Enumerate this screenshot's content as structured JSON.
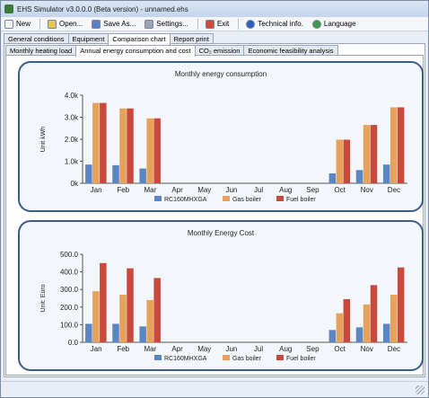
{
  "window": {
    "title": "EHS Simulator v3.0.0.0 (Beta version) - unnamed.ehs"
  },
  "toolbar": {
    "items": [
      {
        "label": "New",
        "icon": "new-file-icon",
        "color": "#f2f2f2"
      },
      {
        "label": "Open...",
        "icon": "open-folder-icon",
        "color": "#e8c25a"
      },
      {
        "label": "Save As...",
        "icon": "save-icon",
        "color": "#5a7fc4"
      },
      {
        "label": "Settings...",
        "icon": "settings-icon",
        "color": "#9aa5b4"
      },
      {
        "label": "Exit",
        "icon": "exit-icon",
        "color": "#d04a3a"
      },
      {
        "label": "Technical info.",
        "icon": "info-icon",
        "color": "#2f5fb8"
      },
      {
        "label": "Language",
        "icon": "globe-icon",
        "color": "#3f9a4a"
      }
    ]
  },
  "main_tabs": [
    "General conditions",
    "Equipment",
    "Comparison chart",
    "Report print"
  ],
  "main_tabs_active": 2,
  "sub_tabs": [
    "Monthly heating load",
    "Annual energy consumption and cost",
    "CO₂ emission",
    "Economic feasibility analysis"
  ],
  "sub_tabs_active": 1,
  "legend_colors": [
    "#5b86c4",
    "#e6a25a",
    "#c94a3c"
  ],
  "chart_data": [
    {
      "type": "bar",
      "title": "Monthly energy consumption",
      "ylabel": "Unit kWh",
      "categories": [
        "Jan",
        "Feb",
        "Mar",
        "Apr",
        "May",
        "Jun",
        "Jul",
        "Aug",
        "Sep",
        "Oct",
        "Nov",
        "Dec"
      ],
      "series": [
        {
          "name": "RC160MHXGA",
          "values": [
            850,
            820,
            670,
            0,
            0,
            0,
            0,
            0,
            0,
            450,
            600,
            850
          ]
        },
        {
          "name": "Gas boiler",
          "values": [
            3650,
            3400,
            2950,
            0,
            0,
            0,
            0,
            0,
            0,
            1980,
            2650,
            3450
          ]
        },
        {
          "name": "Fuel boiler",
          "values": [
            3650,
            3400,
            2950,
            0,
            0,
            0,
            0,
            0,
            0,
            1980,
            2650,
            3450
          ]
        }
      ],
      "ylim": [
        0,
        4000
      ],
      "yticks": [
        0,
        1000,
        2000,
        3000,
        4000
      ],
      "ytick_labels": [
        "0k",
        "1.0k",
        "2.0k",
        "3.0k",
        "4.0k"
      ],
      "grid": false,
      "legend": "bottom"
    },
    {
      "type": "bar",
      "title": "Monthly Energy Cost",
      "ylabel": "Unit: Euro",
      "categories": [
        "Jan",
        "Feb",
        "Mar",
        "Apr",
        "May",
        "Jun",
        "Jul",
        "Aug",
        "Sep",
        "Oct",
        "Nov",
        "Dec"
      ],
      "series": [
        {
          "name": "RC160MHXGA",
          "values": [
            105,
            105,
            90,
            0,
            0,
            0,
            0,
            0,
            0,
            70,
            85,
            105
          ]
        },
        {
          "name": "Gas boiler",
          "values": [
            290,
            270,
            240,
            0,
            0,
            0,
            0,
            0,
            0,
            165,
            215,
            270
          ]
        },
        {
          "name": "Fuel boiler",
          "values": [
            450,
            420,
            365,
            0,
            0,
            0,
            0,
            0,
            0,
            245,
            325,
            425
          ]
        }
      ],
      "ylim": [
        0,
        500
      ],
      "yticks": [
        0,
        100,
        200,
        300,
        400,
        500
      ],
      "ytick_labels": [
        "0.0",
        "100.0",
        "200.0",
        "300.0",
        "400.0",
        "500.0"
      ],
      "grid": false,
      "legend": "bottom"
    }
  ]
}
